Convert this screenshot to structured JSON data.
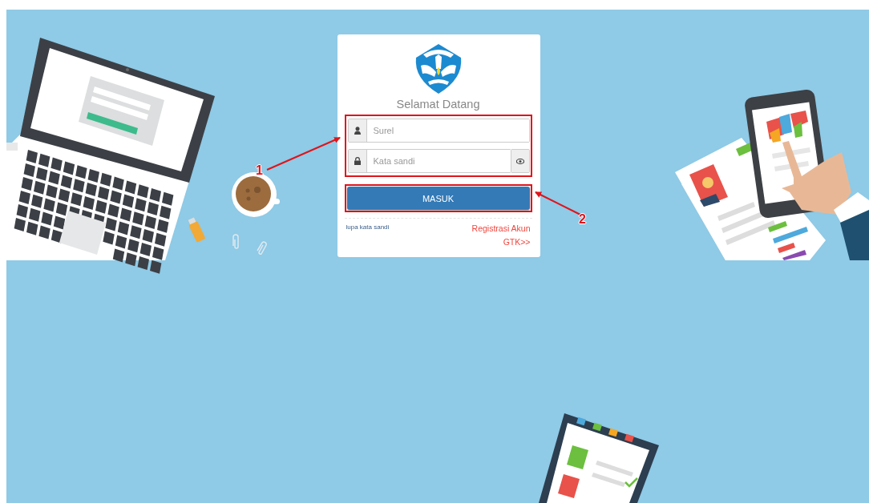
{
  "login": {
    "title": "Selamat Datang",
    "fields": [
      {
        "kind": "email",
        "placeholder": "Surel"
      },
      {
        "kind": "password",
        "placeholder": "Kata sandi"
      }
    ],
    "submit": "MASUK",
    "forgot_link": "lupa kata sandi",
    "register_link": "Registrasi Akun GTK>>"
  },
  "annotations": [
    {
      "label": "1"
    },
    {
      "label": "2"
    }
  ]
}
